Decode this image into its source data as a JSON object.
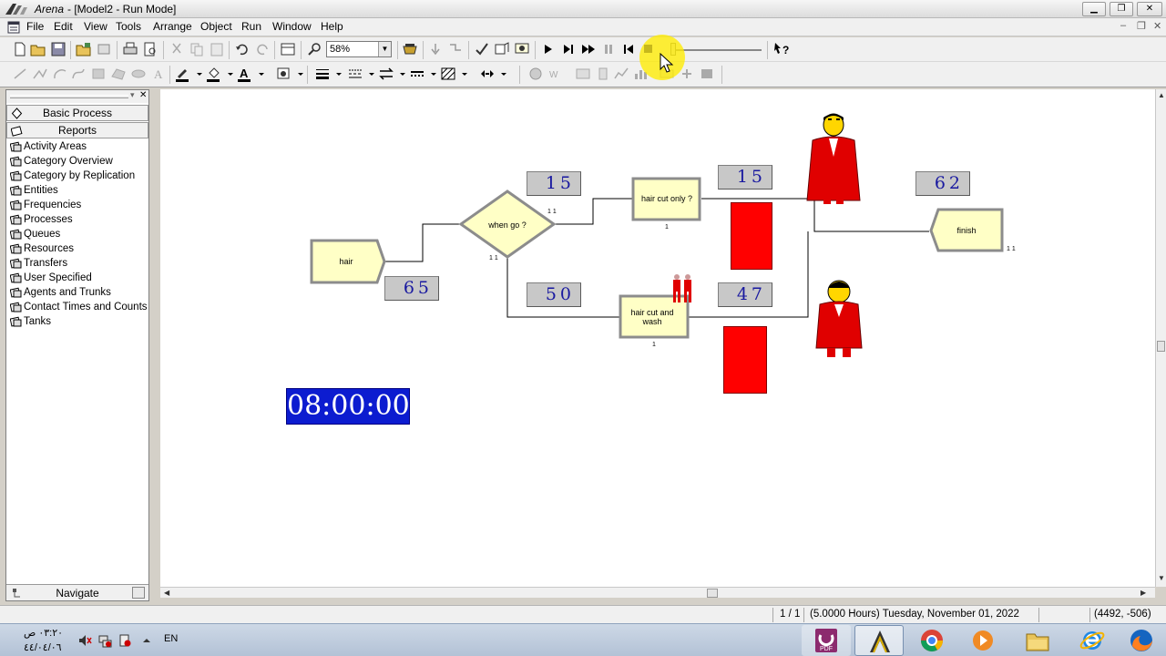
{
  "window": {
    "app_name": "Arena",
    "doc_title": "- [Model2 - Run Mode]",
    "minimize_glyph": "▁",
    "restore_glyph": "❐",
    "close_glyph": "✕"
  },
  "menu": {
    "items": [
      "File",
      "Edit",
      "View",
      "Tools",
      "Arrange",
      "Object",
      "Run",
      "Window",
      "Help"
    ],
    "mdi_minimize": "–",
    "mdi_restore": "❐",
    "mdi_close": "✕"
  },
  "toolbar": {
    "zoom": "58%",
    "zoom_arrow": "▼",
    "run_controls": [
      "go-icon",
      "step-icon",
      "fast-forward-icon",
      "pause-icon",
      "start-over-icon",
      "end-icon"
    ]
  },
  "project_bar": {
    "close_glyph": "✕",
    "pin_glyph": "▾",
    "panels": [
      "Basic Process",
      "Reports"
    ],
    "reports": [
      "Activity Areas",
      "Category Overview",
      "Category by Replication",
      "Entities",
      "Frequencies",
      "Processes",
      "Queues",
      "Resources",
      "Transfers",
      "User Specified",
      "Agents and Trunks",
      "Contact Times and Counts",
      "Tanks"
    ],
    "navigate": "Navigate"
  },
  "model": {
    "modules": {
      "create": "hair",
      "decide": "when go ?",
      "process1": "hair cut only ?",
      "process2": "hair cut and wash",
      "dispose": "finish"
    },
    "counters": {
      "create_out": "65",
      "decide_true": "15",
      "decide_false": "50",
      "process1_out": "15",
      "process2_out": "47",
      "dispose_in": "62"
    },
    "serials": {
      "decide_true": "1 1",
      "decide_false": "1 1",
      "process1": "1",
      "process2": "1",
      "dispose": "1 1"
    },
    "clock": "08:00:00",
    "colors": {
      "module_fill": "#ffffc6",
      "queue": "#ff0000",
      "counter_text": "#1919a0",
      "clock_bg": "#0c1cd0"
    }
  },
  "status": {
    "page": "1 / 1",
    "sim_time": "(5.0000 Hours) Tuesday, November 01, 2022",
    "coords": "(4492, -506)"
  },
  "taskbar": {
    "time": "٠٣:٢٠ ص",
    "date": "٤٤/٠٤/٠٦",
    "lang": "EN",
    "pdf_label": "PDF",
    "apps": [
      "pdf-icon",
      "arena-icon",
      "chrome-icon",
      "media-player-icon",
      "explorer-icon",
      "internet-explorer-icon",
      "firefox-icon"
    ]
  }
}
